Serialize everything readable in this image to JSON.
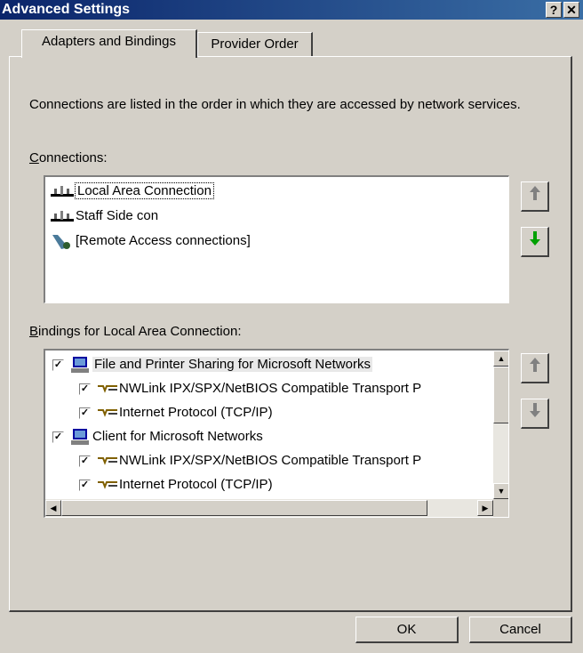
{
  "window": {
    "title": "Advanced Settings",
    "help_glyph": "?",
    "close_glyph": "✕"
  },
  "tabs": [
    {
      "label": "Adapters and Bindings"
    },
    {
      "label": "Provider Order"
    }
  ],
  "description": "Connections are listed in the order in which they are accessed by network services.",
  "connections": {
    "label_first": "C",
    "label_rest": "onnections:",
    "items": [
      {
        "label": "Local Area Connection",
        "icon": "network-connection-icon"
      },
      {
        "label": "Staff Side con",
        "icon": "network-connection-icon"
      },
      {
        "label": "[Remote Access connections]",
        "icon": "remote-access-icon"
      }
    ]
  },
  "bindings": {
    "label_first": "B",
    "label_rest": "indings for Local Area Connection:",
    "items": [
      {
        "label": "File and Printer Sharing for Microsoft Networks",
        "checked": true,
        "level": 0,
        "icon": "file-printer-sharing-icon"
      },
      {
        "label": "NWLink IPX/SPX/NetBIOS Compatible Transport P",
        "checked": true,
        "level": 1,
        "icon": "protocol-icon"
      },
      {
        "label": "Internet Protocol (TCP/IP)",
        "checked": true,
        "level": 1,
        "icon": "protocol-icon"
      },
      {
        "label": "Client for Microsoft Networks",
        "checked": true,
        "level": 0,
        "icon": "client-icon"
      },
      {
        "label": "NWLink IPX/SPX/NetBIOS Compatible Transport P",
        "checked": true,
        "level": 1,
        "icon": "protocol-icon"
      },
      {
        "label": "Internet Protocol (TCP/IP)",
        "checked": true,
        "level": 1,
        "icon": "protocol-icon"
      }
    ]
  },
  "buttons": {
    "ok": "OK",
    "cancel": "Cancel"
  },
  "colors": {
    "titlebar_start": "#0a246a",
    "titlebar_end": "#3a6ea5",
    "face": "#d4d0c8",
    "green_arrow": "#00a000",
    "gray_arrow": "#808080"
  }
}
